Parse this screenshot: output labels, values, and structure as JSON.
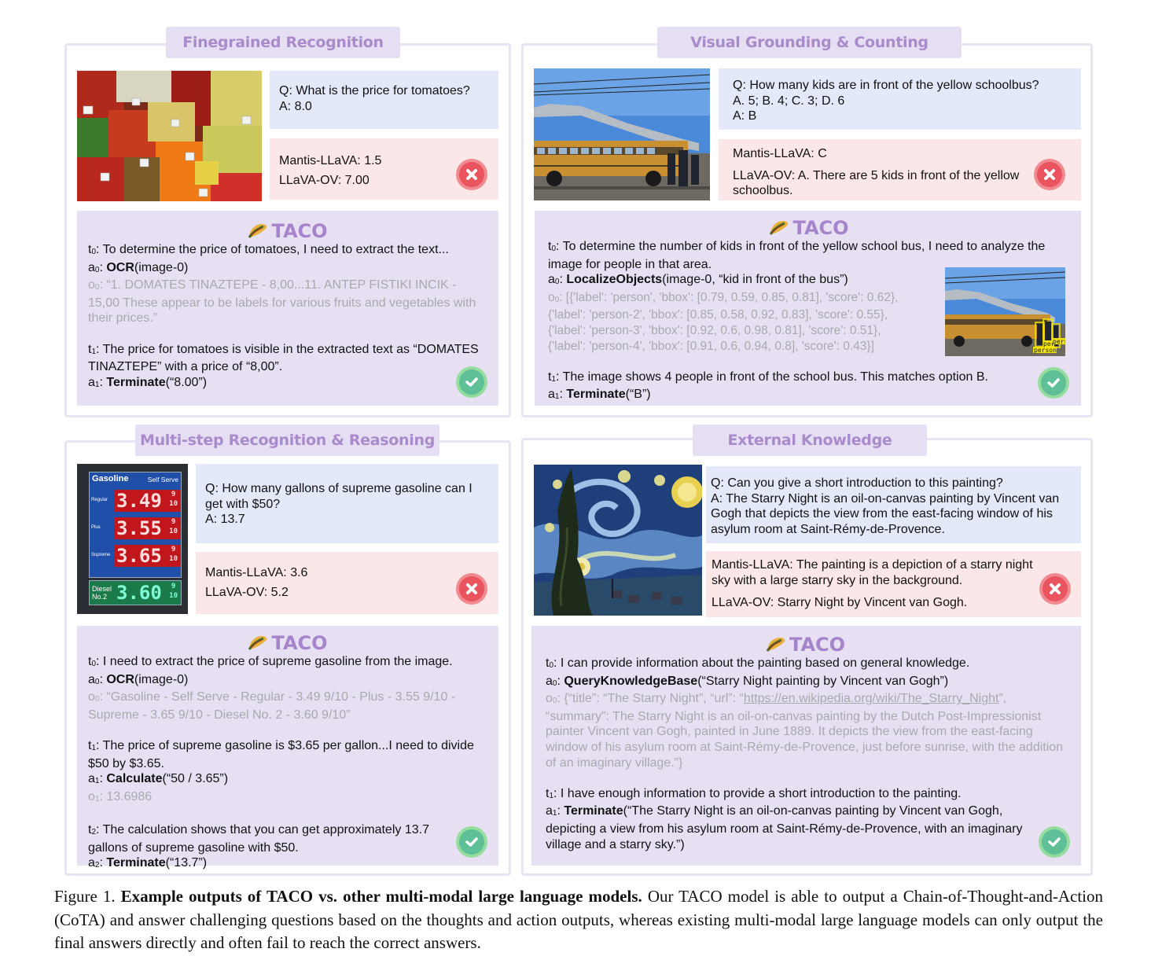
{
  "panels": [
    {
      "title": "Finegrained  Recognition",
      "image_desc": "market fruit and vegetable stand",
      "question": "Q: What is the price for tomatoes?",
      "answer": "A: 8.0",
      "wrong": [
        "Mantis-LLaVA: 1.5",
        "LLaVA-OV: 7.00"
      ],
      "taco_label": "TACO",
      "steps": [
        {
          "k": "t",
          "i": "0",
          "text": ": To determine the price of tomatoes, I need to extract the text..."
        },
        {
          "k": "a",
          "i": "0",
          "fn": "OCR",
          "args": "(image-0)"
        },
        {
          "k": "o",
          "i": "0",
          "text": ": “1. DOMATES TINAZTEPE - 8,00...11. ANTEP FISTIKI INCIK - 15,00 These appear to be labels for various fruits and vegetables with their prices.”"
        },
        {
          "k": "t",
          "i": "1",
          "text": ": The price for tomatoes is visible in the extracted text as “DOMATES TINAZTEPE” with a price of “8,00”."
        },
        {
          "k": "a",
          "i": "1",
          "fn": "Terminate",
          "args": "(“8.00”)"
        }
      ]
    },
    {
      "title": "Visual Grounding & Counting",
      "image_desc": "yellow school bus with kids",
      "question": "Q: How many kids are in front of the yellow schoolbus?",
      "options": "A. 5; B. 4; C. 3; D. 6",
      "answer": "A: B",
      "wrong": [
        "Mantis-LLaVA: C",
        "LLaVA-OV: A. There are 5 kids in front of the yellow schoolbus."
      ],
      "taco_label": "TACO",
      "steps": [
        {
          "k": "t",
          "i": "0",
          "text": ": To determine the number of kids in front of the yellow school bus, I need to analyze the image for people in that area."
        },
        {
          "k": "a",
          "i": "0",
          "fn": "LocalizeObjects",
          "args": "(image-0, “kid in front of the bus”)"
        },
        {
          "k": "o",
          "i": "0",
          "lines": [
            ": [{'label': 'person', 'bbox': [0.79, 0.59, 0.85, 0.81], 'score': 0.62},",
            "{'label': 'person-2', 'bbox': [0.85, 0.58, 0.92, 0.83], 'score': 0.55},",
            "{'label': 'person-3', 'bbox': [0.92, 0.6, 0.98, 0.81], 'score': 0.51},",
            "{'label': 'person-4', 'bbox': [0.91, 0.6, 0.94, 0.8], 'score': 0.43}]"
          ]
        },
        {
          "k": "t",
          "i": "1",
          "text": ": The image shows 4 people in front of the school bus. This matches option B."
        },
        {
          "k": "a",
          "i": "1",
          "fn": "Terminate",
          "args": "(“B”)"
        }
      ],
      "bbox_labels": [
        "person",
        "per",
        "perso"
      ]
    },
    {
      "title": "Multi-step Recognition & Reasoning",
      "image_desc": "gasoline price sign",
      "sign": {
        "header_left": "Gasoline",
        "header_right": "Self Serve",
        "rows": [
          {
            "label": "Regular",
            "price": "3.49"
          },
          {
            "label": "Plus",
            "price": "3.55"
          },
          {
            "label": "Supreme",
            "price": "3.65"
          },
          {
            "label": "Diesel No.2",
            "price": "3.60"
          }
        ],
        "frac_top": "9",
        "frac_bottom": "10"
      },
      "question": "Q: How many gallons of supreme gasoline can I get with $50?",
      "answer": "A: 13.7",
      "wrong": [
        "Mantis-LLaVA: 3.6",
        "LLaVA-OV: 5.2"
      ],
      "taco_label": "TACO",
      "steps": [
        {
          "k": "t",
          "i": "0",
          "text": ": I need to extract the price of supreme gasoline from the image."
        },
        {
          "k": "a",
          "i": "0",
          "fn": "OCR",
          "args": "(image-0)"
        },
        {
          "k": "o",
          "i": "0",
          "text": ": “Gasoline - Self Serve - Regular - 3.49 9/10 - Plus - 3.55 9/10 - Supreme - 3.65 9/10 - Diesel No. 2 - 3.60 9/10”"
        },
        {
          "k": "t",
          "i": "1",
          "text": ": The price of supreme gasoline is $3.65 per gallon...I need to divide $50 by $3.65."
        },
        {
          "k": "a",
          "i": "1",
          "fn": "Calculate",
          "args": "(“50 / 3.65”)"
        },
        {
          "k": "o",
          "i": "1",
          "text": ": 13.6986"
        },
        {
          "k": "t",
          "i": "2",
          "text": ": The calculation shows that you can get approximately 13.7 gallons of supreme gasoline with $50."
        },
        {
          "k": "a",
          "i": "2",
          "fn": "Terminate",
          "args": "(“13.7”)"
        }
      ]
    },
    {
      "title": "External Knowledge",
      "image_desc": "The Starry Night painting",
      "question": "Q: Can you give a short introduction to this painting?",
      "answer": "A: The Starry Night is an oil-on-canvas painting by Vincent van Gogh that depicts the view from the east-facing window of his asylum room at Saint-Rémy-de-Provence.",
      "wrong": [
        "Mantis-LLaVA: The painting is a depiction of a starry night sky with a large starry sky in the background.",
        "LLaVA-OV: Starry Night by Vincent van Gogh."
      ],
      "taco_label": "TACO",
      "steps": [
        {
          "k": "t",
          "i": "0",
          "text": ": I can provide information about the painting based on general knowledge."
        },
        {
          "k": "a",
          "i": "0",
          "fn": "QueryKnowledgeBase",
          "args": "(“Starry Night painting by Vincent van Gogh”)"
        },
        {
          "k": "o",
          "i": "0",
          "pre": ": {“title”: “The Starry Night”, “url”: “",
          "url": "https://en.wikipedia.org/wiki/The_Starry_Night",
          "post": "”, “summary”: The Starry Night is an oil-on-canvas painting by the Dutch Post-Impressionist painter Vincent van Gogh, painted in June 1889. It depicts the view from the east-facing window of his asylum room at Saint-Rémy-de-Provence, just before sunrise, with the addition of an imaginary village.”}"
        },
        {
          "k": "t",
          "i": "1",
          "text": ": I have enough information to provide a short introduction to the painting."
        },
        {
          "k": "a",
          "i": "1",
          "fn": "Terminate",
          "args": "(“The Starry Night is an oil-on-canvas painting by Vincent van Gogh, depicting a view from his asylum room at Saint-Rémy-de-Provence, with an imaginary village and a starry sky.”)"
        }
      ]
    }
  ],
  "caption": {
    "label": "Figure 1.",
    "bold": "Example outputs of TACO vs. other multi-modal large language models.",
    "text": "Our TACO model is able to output a Chain-of-Thought-and-Action (CoTA) and answer challenging questions based on the thoughts and action outputs, whereas existing multi-modal large language models can only output the final answers directly and often fail to reach the correct answers."
  },
  "colors": {
    "title_bg": "#e6def2",
    "title_text": "#a98bcb",
    "question_bg": "#e3e9f8",
    "wrong_bg": "#fbe7e7",
    "taco_bg": "#e7e0f2",
    "observation_text": "#a9a9ad",
    "wrong_icon": "#e9545f",
    "correct_icon": "#5fbf97"
  }
}
